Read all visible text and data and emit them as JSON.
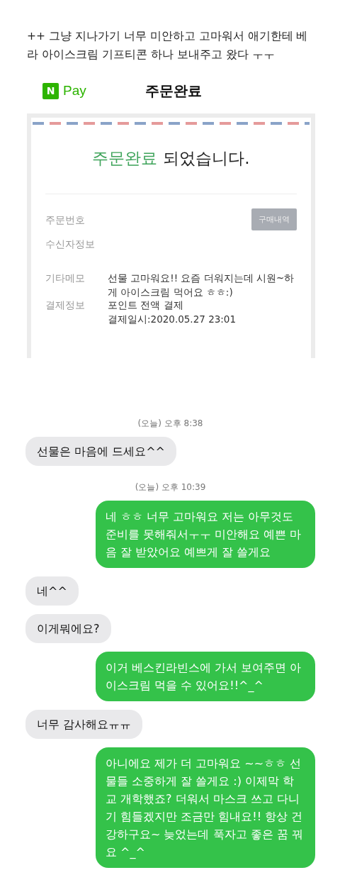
{
  "post_text": "++ 그냥 지나가기 너무 미안하고 고마워서 애기한테 베라 아이스크림 기프티콘 하나 보내주고 왔다 ㅜㅜ",
  "order": {
    "logo_letter": "N",
    "logo_text": "Pay",
    "title": "주문완료",
    "headline_highlight": "주문완료",
    "headline_rest": "되었습니다.",
    "history_button": "구매내역",
    "fields": [
      {
        "label": "주문번호"
      },
      {
        "label": "수신자정보"
      },
      {
        "label": "기타메모",
        "value": "선물 고마워요!! 요즘 더워지는데 시원~하게 아이스크림 먹어요 ㅎㅎ:)"
      },
      {
        "label": "결제정보",
        "value": "포인트 전액 결제",
        "value_2": "결제일시:2020.05.27 23:01"
      }
    ]
  },
  "messages": [
    {
      "kind": "timestamp",
      "text": "(오늘) 오후 8:38"
    },
    {
      "kind": "received",
      "text": "선물은 마음에  드세요^^"
    },
    {
      "kind": "timestamp",
      "text": "(오늘) 오후 10:39"
    },
    {
      "kind": "sent",
      "text": "네 ㅎㅎ 너무 고마워요 저는 아무것도 준비를 못해줘서ㅜㅜ 미안해요 예쁜 마음 잘 받았어요 예쁘게 잘 쓸게요"
    },
    {
      "kind": "received",
      "text": "네^^"
    },
    {
      "kind": "received",
      "text": "이게뭐에요?"
    },
    {
      "kind": "sent",
      "text": "이거 베스킨라빈스에 가서 보여주면 아이스크림 먹을 수 있어요!!^_^"
    },
    {
      "kind": "received",
      "text": "너무  감사해요ㅠㅠ"
    },
    {
      "kind": "sent",
      "text": "아니에요 제가 더 고마워요 ~~ㅎㅎ 선물들 소중하게 잘 쓸게요 :) 이제막 학교 개학했죠? 더워서 마스크 쓰고 다니기 힘들겠지만 조금만 힘내요!! 항상 건강하구요~ 늦었는데 푹자고 좋은 꿈 꿔요 ^_^"
    }
  ]
}
